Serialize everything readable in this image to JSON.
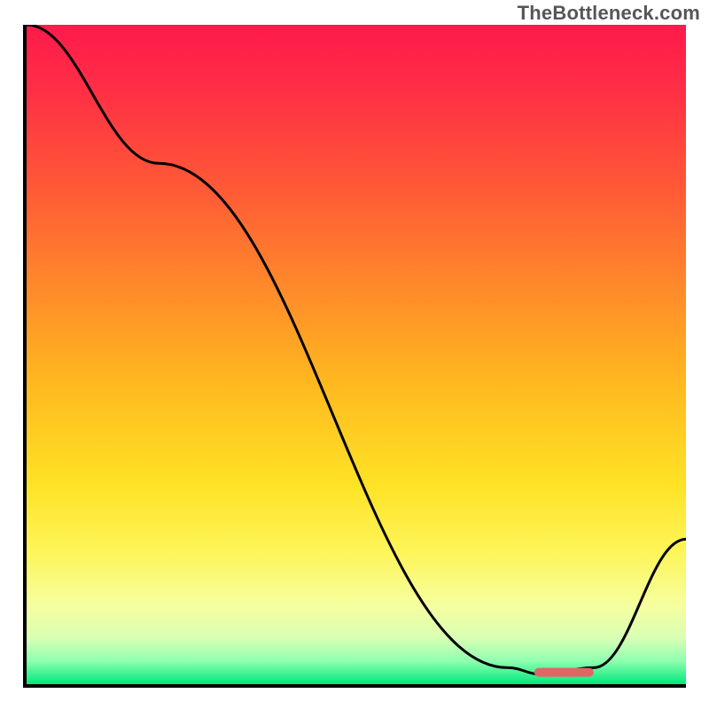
{
  "watermark": "TheBottleneck.com",
  "colors": {
    "gradient_stops": [
      {
        "offset": 0.0,
        "color": "#ff1a4b"
      },
      {
        "offset": 0.1,
        "color": "#ff2f45"
      },
      {
        "offset": 0.25,
        "color": "#ff5a36"
      },
      {
        "offset": 0.4,
        "color": "#ff8a2a"
      },
      {
        "offset": 0.55,
        "color": "#ffba1f"
      },
      {
        "offset": 0.7,
        "color": "#ffe326"
      },
      {
        "offset": 0.8,
        "color": "#fdf55a"
      },
      {
        "offset": 0.88,
        "color": "#f6ff9e"
      },
      {
        "offset": 0.93,
        "color": "#d9ffb4"
      },
      {
        "offset": 0.965,
        "color": "#8effb0"
      },
      {
        "offset": 1.0,
        "color": "#00e87a"
      }
    ],
    "curve": "#000000",
    "marker": "#e06666"
  },
  "chart_data": {
    "type": "line",
    "title": "",
    "xlabel": "",
    "ylabel": "",
    "xlim": [
      0,
      100
    ],
    "ylim": [
      0,
      100
    ],
    "grid": false,
    "legend": false,
    "x": [
      0,
      20,
      73,
      78,
      86,
      100
    ],
    "values": [
      100,
      79,
      2.5,
      1.5,
      2.5,
      22
    ],
    "marker": {
      "x_start": 77,
      "x_end": 86,
      "y": 1.8
    },
    "notes": "Curve descends from top-left, flattens at minimum near x≈78-85, then rises to the right. Marker is a short horizontal red bar at the trough."
  }
}
